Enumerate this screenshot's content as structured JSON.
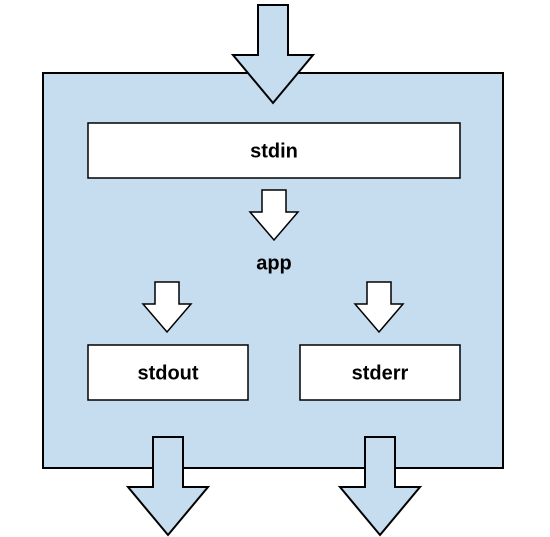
{
  "labels": {
    "stdin": "stdin",
    "app": "app",
    "stdout": "stdout",
    "stderr": "stderr"
  }
}
